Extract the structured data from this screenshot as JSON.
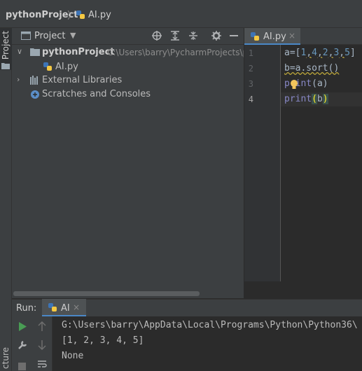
{
  "breadcrumb": {
    "project": "pythonProject",
    "separator": "〉",
    "file": "AI.py"
  },
  "left_strip": {
    "project_tab": "Project",
    "structure_tab": "cture"
  },
  "project_panel": {
    "title": "Project",
    "toolbar_icons": [
      "locate-icon",
      "expand-all-icon",
      "collapse-all-icon",
      "settings-icon",
      "hide-icon"
    ],
    "tree": {
      "root_name": "pythonProject",
      "root_path": "C:\\Users\\barry\\PycharmProjects\\p",
      "file": "AI.py",
      "external_libraries": "External Libraries",
      "scratches": "Scratches and Consoles"
    }
  },
  "editor": {
    "tab_label": "AI.py",
    "line_numbers": [
      "1",
      "2",
      "3",
      "4"
    ],
    "line1": {
      "a": "a=[",
      "n1": "1",
      "c1": ",",
      "n2": "4",
      "c2": ",",
      "n3": "2",
      "c3": ",",
      "n4": "3",
      "c4": ",",
      "n5": "5",
      "end": "]"
    },
    "line2": "b=a.sort()",
    "line3": {
      "kw_start": "pr",
      "kw_end": "int",
      "args": "(a)"
    },
    "line4": {
      "kw": "print",
      "open": "(",
      "arg": "b",
      "close": ")"
    }
  },
  "run_window": {
    "label": "Run:",
    "tab_label": "AI",
    "console": [
      "G:\\Users\\barry\\AppData\\Local\\Programs\\Python\\Python36\\",
      "[1, 2, 3, 4, 5]",
      "None"
    ]
  },
  "colors": {
    "accent": "#4a88c7",
    "keyword": "#8888c6",
    "number": "#6897bb",
    "run_green": "#499c54"
  }
}
